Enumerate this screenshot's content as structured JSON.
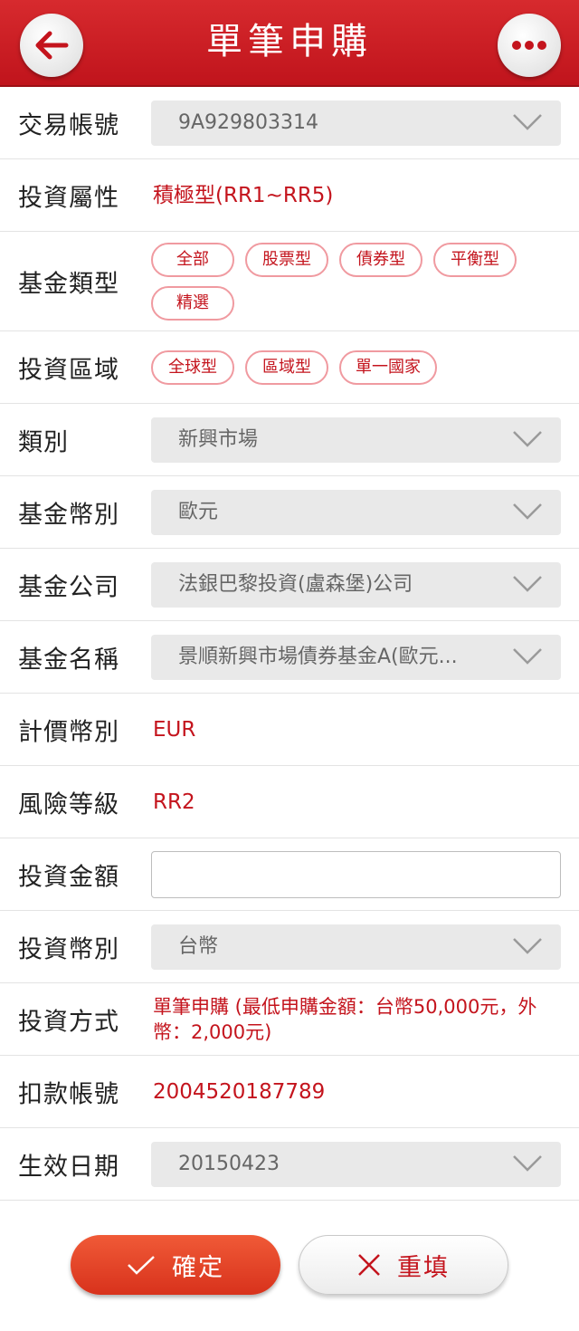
{
  "header": {
    "title": "單筆申購",
    "back_icon": "arrow-left-icon",
    "more_icon": "more-dots-icon"
  },
  "colors": {
    "brand_red": "#c4141d",
    "header_red": "#d72a2e",
    "confirm_orange": "#e8442a"
  },
  "form": {
    "account": {
      "label": "交易帳號",
      "value": "9A929803314"
    },
    "risk_attr": {
      "label": "投資屬性",
      "value": "積極型(RR1~RR5)"
    },
    "fund_type": {
      "label": "基金類型",
      "chips": [
        "全部",
        "股票型",
        "債券型",
        "平衡型",
        "精選"
      ]
    },
    "invest_region": {
      "label": "投資區域",
      "chips": [
        "全球型",
        "區域型",
        "單一國家"
      ]
    },
    "category": {
      "label": "類別",
      "value": "新興市場"
    },
    "fund_currency": {
      "label": "基金幣別",
      "value": "歐元"
    },
    "fund_company": {
      "label": "基金公司",
      "value": "法銀巴黎投資(盧森堡)公司"
    },
    "fund_name": {
      "label": "基金名稱",
      "value": "景順新興市場債券基金A(歐元..."
    },
    "pricing_currency": {
      "label": "計價幣別",
      "value": "EUR"
    },
    "risk_level": {
      "label": "風險等級",
      "value": "RR2"
    },
    "amount": {
      "label": "投資金額",
      "value": ""
    },
    "invest_currency": {
      "label": "投資幣別",
      "value": "台幣"
    },
    "method": {
      "label": "投資方式",
      "value": "單筆申購 (最低申購金額：台幣50,000元，外幣：2,000元)"
    },
    "debit_account": {
      "label": "扣款帳號",
      "value": "2004520187789"
    },
    "effective_date": {
      "label": "生效日期",
      "value": "20150423"
    }
  },
  "actions": {
    "confirm_label": "確定",
    "reset_label": "重填"
  }
}
